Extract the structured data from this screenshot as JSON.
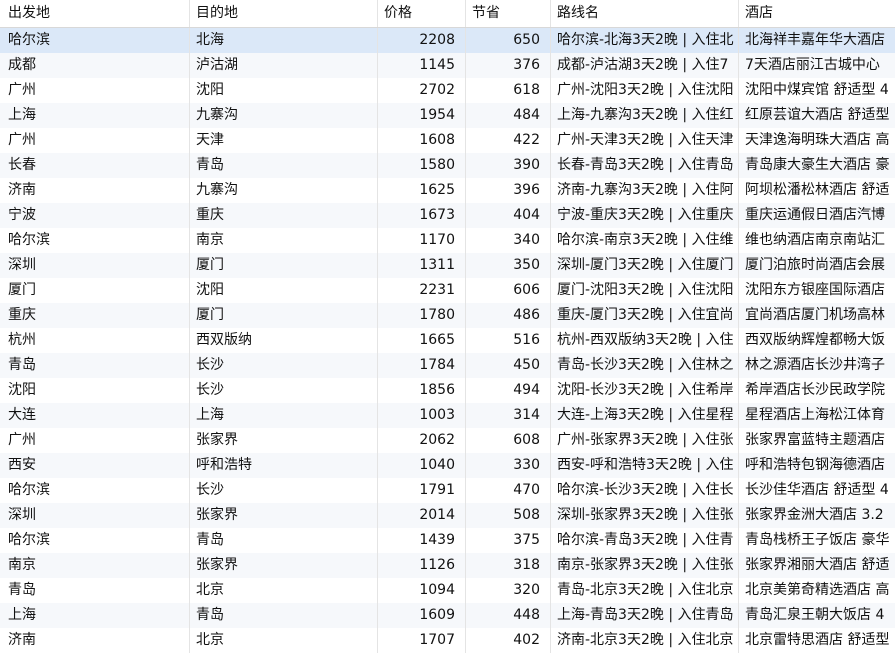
{
  "columns": {
    "from": "出发地",
    "to": "目的地",
    "price": "价格",
    "save": "节省",
    "route": "路线名",
    "hotel": "酒店"
  },
  "selected_row": 0,
  "rows": [
    {
      "from": "哈尔滨",
      "to": "北海",
      "price": "2208",
      "save": "650",
      "route": "哈尔滨-北海3天2晚 | 入住北",
      "hotel": "北海祥丰嘉年华大酒店"
    },
    {
      "from": "成都",
      "to": "泸沽湖",
      "price": "1145",
      "save": "376",
      "route": "成都-泸沽湖3天2晚 | 入住7",
      "hotel": "7天酒店丽江古城中心"
    },
    {
      "from": "广州",
      "to": "沈阳",
      "price": "2702",
      "save": "618",
      "route": "广州-沈阳3天2晚 | 入住沈阳",
      "hotel": "沈阳中煤宾馆 舒适型 4"
    },
    {
      "from": "上海",
      "to": "九寨沟",
      "price": "1954",
      "save": "484",
      "route": "上海-九寨沟3天2晚 | 入住红",
      "hotel": "红原芸谊大酒店 舒适型"
    },
    {
      "from": "广州",
      "to": "天津",
      "price": "1608",
      "save": "422",
      "route": "广州-天津3天2晚 | 入住天津",
      "hotel": "天津逸海明珠大酒店 高"
    },
    {
      "from": "长春",
      "to": "青岛",
      "price": "1580",
      "save": "390",
      "route": "长春-青岛3天2晚 | 入住青岛",
      "hotel": "青岛康大豪生大酒店 豪"
    },
    {
      "from": "济南",
      "to": "九寨沟",
      "price": "1625",
      "save": "396",
      "route": "济南-九寨沟3天2晚 | 入住阿",
      "hotel": "阿坝松潘松林酒店 舒适"
    },
    {
      "from": "宁波",
      "to": "重庆",
      "price": "1673",
      "save": "404",
      "route": "宁波-重庆3天2晚 | 入住重庆",
      "hotel": "重庆运通假日酒店汽博"
    },
    {
      "from": "哈尔滨",
      "to": "南京",
      "price": "1170",
      "save": "340",
      "route": "哈尔滨-南京3天2晚 | 入住维",
      "hotel": "维也纳酒店南京南站汇"
    },
    {
      "from": "深圳",
      "to": "厦门",
      "price": "1311",
      "save": "350",
      "route": "深圳-厦门3天2晚 | 入住厦门",
      "hotel": "厦门泊旅时尚酒店会展"
    },
    {
      "from": "厦门",
      "to": "沈阳",
      "price": "2231",
      "save": "606",
      "route": "厦门-沈阳3天2晚 | 入住沈阳",
      "hotel": "沈阳东方银座国际酒店"
    },
    {
      "from": "重庆",
      "to": "厦门",
      "price": "1780",
      "save": "486",
      "route": "重庆-厦门3天2晚 | 入住宜尚",
      "hotel": "宜尚酒店厦门机场高林"
    },
    {
      "from": "杭州",
      "to": "西双版纳",
      "price": "1665",
      "save": "516",
      "route": "杭州-西双版纳3天2晚 | 入住",
      "hotel": "西双版纳辉煌都畅大饭"
    },
    {
      "from": "青岛",
      "to": "长沙",
      "price": "1784",
      "save": "450",
      "route": "青岛-长沙3天2晚 | 入住林之",
      "hotel": "林之源酒店长沙井湾子"
    },
    {
      "from": "沈阳",
      "to": "长沙",
      "price": "1856",
      "save": "494",
      "route": "沈阳-长沙3天2晚 | 入住希岸",
      "hotel": "希岸酒店长沙民政学院"
    },
    {
      "from": "大连",
      "to": "上海",
      "price": "1003",
      "save": "314",
      "route": "大连-上海3天2晚 | 入住星程",
      "hotel": "星程酒店上海松江体育"
    },
    {
      "from": "广州",
      "to": "张家界",
      "price": "2062",
      "save": "608",
      "route": "广州-张家界3天2晚 | 入住张",
      "hotel": "张家界富蓝特主题酒店"
    },
    {
      "from": "西安",
      "to": "呼和浩特",
      "price": "1040",
      "save": "330",
      "route": "西安-呼和浩特3天2晚 | 入住",
      "hotel": "呼和浩特包钢海德酒店"
    },
    {
      "from": "哈尔滨",
      "to": "长沙",
      "price": "1791",
      "save": "470",
      "route": "哈尔滨-长沙3天2晚 | 入住长",
      "hotel": "长沙佳华酒店 舒适型 4"
    },
    {
      "from": "深圳",
      "to": "张家界",
      "price": "2014",
      "save": "508",
      "route": "深圳-张家界3天2晚 | 入住张",
      "hotel": "张家界金洲大酒店 3.2"
    },
    {
      "from": "哈尔滨",
      "to": "青岛",
      "price": "1439",
      "save": "375",
      "route": "哈尔滨-青岛3天2晚 | 入住青",
      "hotel": "青岛栈桥王子饭店 豪华"
    },
    {
      "from": "南京",
      "to": "张家界",
      "price": "1126",
      "save": "318",
      "route": "南京-张家界3天2晚 | 入住张",
      "hotel": "张家界湘丽大酒店 舒适"
    },
    {
      "from": "青岛",
      "to": "北京",
      "price": "1094",
      "save": "320",
      "route": "青岛-北京3天2晚 | 入住北京",
      "hotel": "北京美第奇精选酒店 高"
    },
    {
      "from": "上海",
      "to": "青岛",
      "price": "1609",
      "save": "448",
      "route": "上海-青岛3天2晚 | 入住青岛",
      "hotel": "青岛汇泉王朝大饭店 4"
    },
    {
      "from": "济南",
      "to": "北京",
      "price": "1707",
      "save": "402",
      "route": "济南-北京3天2晚 | 入住北京",
      "hotel": "北京雷特思酒店 舒适型"
    }
  ]
}
